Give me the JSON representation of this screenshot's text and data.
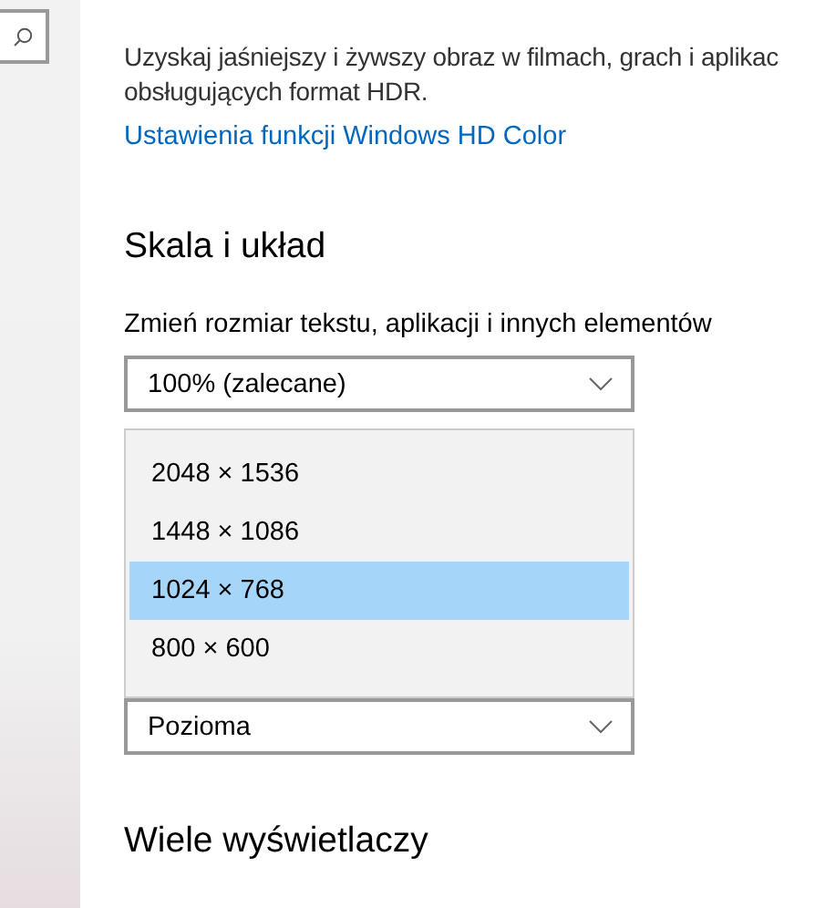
{
  "intro": {
    "lines": [
      "Uzyskaj jaśniejszy i żywszy obraz w filmach, grach i aplikac",
      "obsługujących format HDR."
    ],
    "link": "Ustawienia funkcji Windows HD Color"
  },
  "scale_section": {
    "heading": "Skala i układ",
    "label": "Zmień rozmiar tekstu, aplikacji i innych elementów",
    "scale_dropdown": {
      "value": "100% (zalecane)"
    },
    "resolution_menu": [
      {
        "label": "2048 × 1536",
        "selected": false
      },
      {
        "label": "1448 × 1086",
        "selected": false
      },
      {
        "label": "1024 × 768",
        "selected": true
      },
      {
        "label": "800 × 600",
        "selected": false
      }
    ],
    "orientation_dropdown": {
      "value": "Pozioma"
    }
  },
  "multi_display_section": {
    "heading": "Wiele wyświetlaczy"
  }
}
